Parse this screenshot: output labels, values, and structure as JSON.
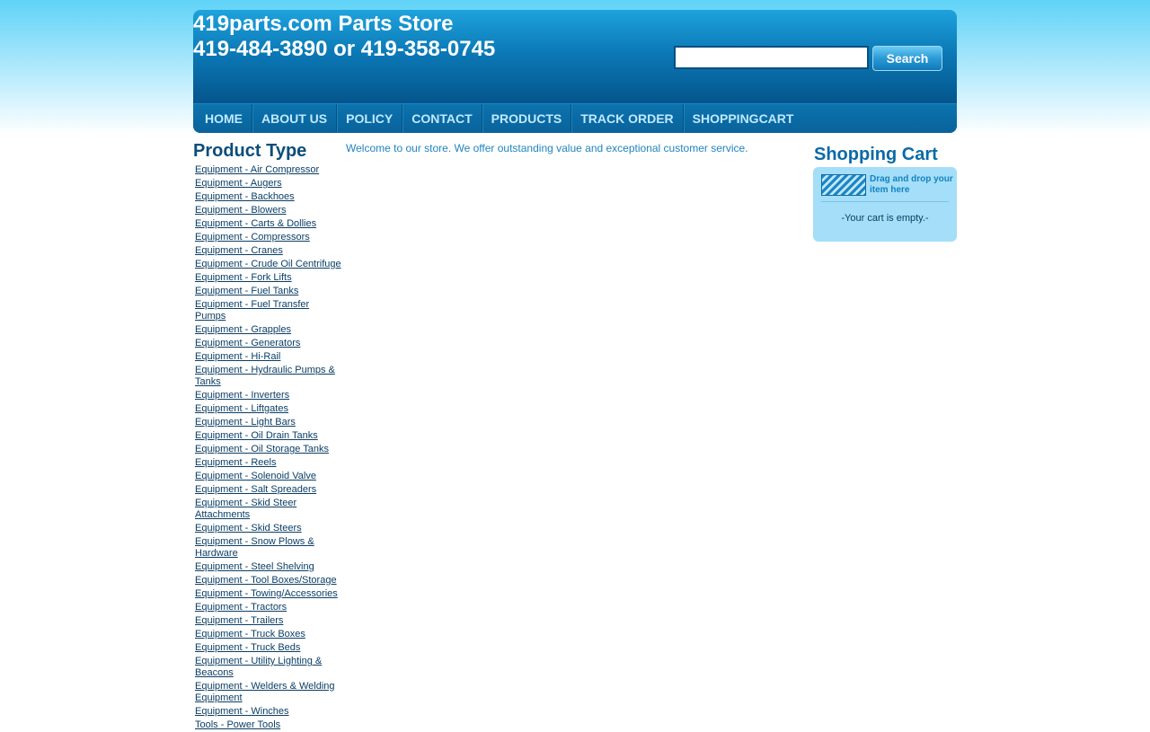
{
  "header": {
    "title_line1": "419parts.com Parts Store",
    "title_line2": "419-484-3890 or 419-358-0745",
    "search_button": "Search"
  },
  "nav": [
    "HOME",
    "ABOUT US",
    "POLICY",
    "CONTACT",
    "PRODUCTS",
    "TRACK ORDER",
    "SHOPPINGCART"
  ],
  "sidebar": {
    "title": "Product Type",
    "items": [
      "Equipment - Air Compressor",
      "Equipment - Augers",
      "Equipment - Backhoes",
      "Equipment - Blowers",
      "Equipment - Carts & Dollies",
      "Equipment - Compressors",
      "Equipment - Cranes",
      "Equipment - Crude Oil Centrifuge",
      "Equipment - Fork Lifts",
      "Equipment - Fuel Tanks",
      "Equipment - Fuel Transfer Pumps",
      "Equipment - Grapples",
      "Equipment - Generators",
      "Equipment - Hi-Rail",
      "Equipment - Hydraulic Pumps & Tanks",
      "Equipment - Inverters",
      "Equipment - Liftgates",
      "Equipment - Light Bars",
      "Equipment - Oil Drain Tanks",
      "Equipment - Oil Storage Tanks",
      "Equipment - Reels",
      "Equipment - Solenoid Valve",
      "Equipment - Salt Spreaders",
      "Equipment - Skid Steer Attachments",
      "Equipment - Skid Steers",
      "Equipment - Snow Plows & Hardware",
      "Equipment - Steel Shelving",
      "Equipment - Tool Boxes/Storage",
      "Equipment - Towing/Accessories",
      "Equipment - Tractors",
      "Equipment - Trailers",
      "Equipment - Truck Boxes",
      "Equipment - Truck Beds",
      "Equipment - Utility Lighting & Beacons",
      "Equipment - Welders & Welding Equipment",
      "Equipment - Winches",
      "Tools - Power Tools"
    ]
  },
  "main": {
    "welcome": "Welcome to our store. We offer outstanding value and exceptional customer service."
  },
  "cart": {
    "title": "Shopping Cart",
    "drop_text": "Drag and drop your item here",
    "empty_text": "-Your cart is empty.-"
  },
  "colors": {
    "header_blue": "#0b79b6",
    "nav_text": "#bfe9ff",
    "link": "#0b3e66",
    "welcome_text": "#2084be",
    "cart_bg": "#a4def8"
  }
}
